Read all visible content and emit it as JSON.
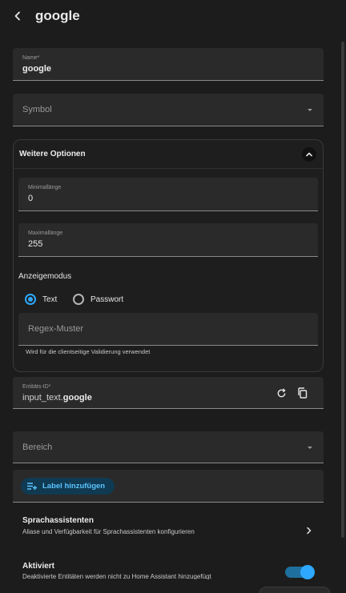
{
  "header": {
    "title": "google"
  },
  "fields": {
    "name": {
      "label": "Name*",
      "value": "google"
    },
    "symbol": {
      "placeholder": "Symbol"
    },
    "min_length": {
      "label": "Minimallänge",
      "value": "0"
    },
    "max_length": {
      "label": "Maximallänge",
      "value": "255"
    },
    "regex": {
      "placeholder": "Regex-Muster",
      "helper": "Wird für die clientseitige Validierung verwendet"
    },
    "entity_id": {
      "label": "Entitäts-ID*",
      "prefix": "input_text.",
      "value": "google"
    },
    "area": {
      "placeholder": "Bereich"
    }
  },
  "expander": {
    "title": "Weitere Optionen"
  },
  "display_mode": {
    "label": "Anzeigemodus",
    "options": [
      {
        "label": "Text",
        "checked": true
      },
      {
        "label": "Passwort",
        "checked": false
      }
    ]
  },
  "labels": {
    "add_label": "Label hinzufügen"
  },
  "voice": {
    "title": "Sprachassistenten",
    "subtitle": "Aliase und Verfügbarkeit für Sprachassistenten konfigurieren"
  },
  "enabled": {
    "title": "Aktiviert",
    "subtitle": "Deaktivierte Entitäten werden nicht zu Home Assistant hinzugefügt",
    "value": true
  },
  "colors": {
    "accent": "#2ea8ff",
    "background": "#1c1c1c",
    "surface": "#2a2a2a"
  },
  "icons": {
    "back": "arrow-left-icon",
    "dropdown": "menu-down-icon",
    "collapse": "chevron-up-icon",
    "restore": "restore-icon",
    "copy": "copy-icon",
    "label_add": "label-add-icon",
    "chevron": "chevron-right-icon"
  }
}
